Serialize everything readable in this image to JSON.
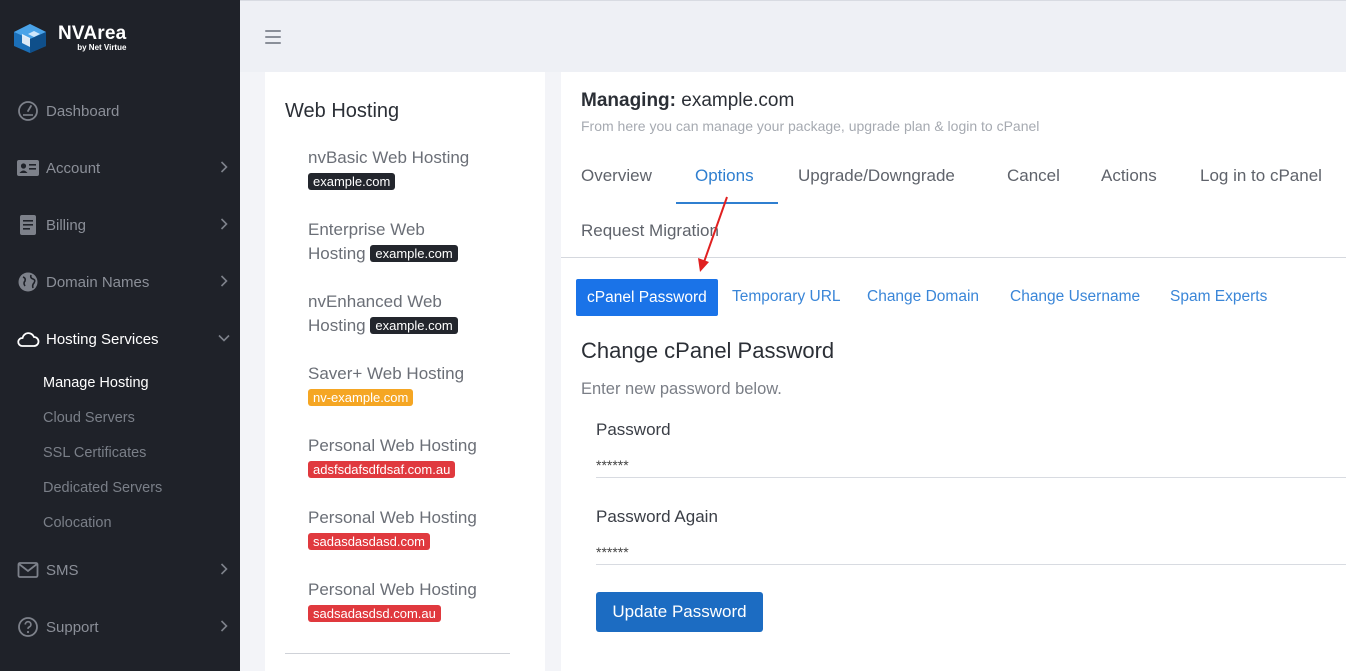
{
  "brand": {
    "name": "NVArea",
    "sub": "by Net Virtue"
  },
  "sidebar": {
    "items": [
      {
        "label": "Dashboard",
        "icon": "speedometer-icon"
      },
      {
        "label": "Account",
        "icon": "id-card-icon"
      },
      {
        "label": "Billing",
        "icon": "invoice-icon"
      },
      {
        "label": "Domain Names",
        "icon": "globe-icon"
      },
      {
        "label": "Hosting Services",
        "icon": "cloud-icon"
      },
      {
        "label": "SMS",
        "icon": "envelope-icon"
      },
      {
        "label": "Support",
        "icon": "help-icon"
      }
    ],
    "hosting_sub": [
      "Manage Hosting",
      "Cloud Servers",
      "SSL Certificates",
      "Dedicated Servers",
      "Colocation"
    ]
  },
  "hosting_list": {
    "title": "Web Hosting",
    "services": [
      {
        "name": "nvBasic Web Hosting",
        "domain": "example.com",
        "status": "dark"
      },
      {
        "name": "Enterprise Web Hosting",
        "domain": "example.com",
        "status": "dark"
      },
      {
        "name": "nvEnhanced Web Hosting",
        "domain": "example.com",
        "status": "dark"
      },
      {
        "name": "Saver+ Web Hosting",
        "domain": "nv-example.com",
        "status": "orange"
      },
      {
        "name": "Personal Web Hosting",
        "domain": "adsfsdafsdfdsaf.com.au",
        "status": "red"
      },
      {
        "name": "Personal Web Hosting",
        "domain": "sadasdasdasd.com",
        "status": "red"
      },
      {
        "name": "Personal Web Hosting",
        "domain": "sadsadasdsd.com.au",
        "status": "red"
      }
    ]
  },
  "main": {
    "managing_label": "Managing:",
    "managing_domain": "example.com",
    "subtitle": "From here you can manage your package, upgrade plan & login to cPanel",
    "tabs": [
      "Overview",
      "Options",
      "Upgrade/Downgrade",
      "Cancel",
      "Actions",
      "Log in to cPanel",
      "Request Migration"
    ],
    "active_tab": "Options",
    "subtabs": [
      "cPanel Password",
      "Temporary URL",
      "Change Domain",
      "Change Username",
      "Spam Experts"
    ],
    "section_title": "Change cPanel Password",
    "section_sub": "Enter new password below.",
    "password_label": "Password",
    "password_value": "******",
    "password_again_label": "Password Again",
    "password_again_value": "******",
    "update_button": "Update Password"
  },
  "colors": {
    "accent": "#1a73e8",
    "sidebar_bg": "#1f2229",
    "annotation_arrow": "#e02020"
  }
}
